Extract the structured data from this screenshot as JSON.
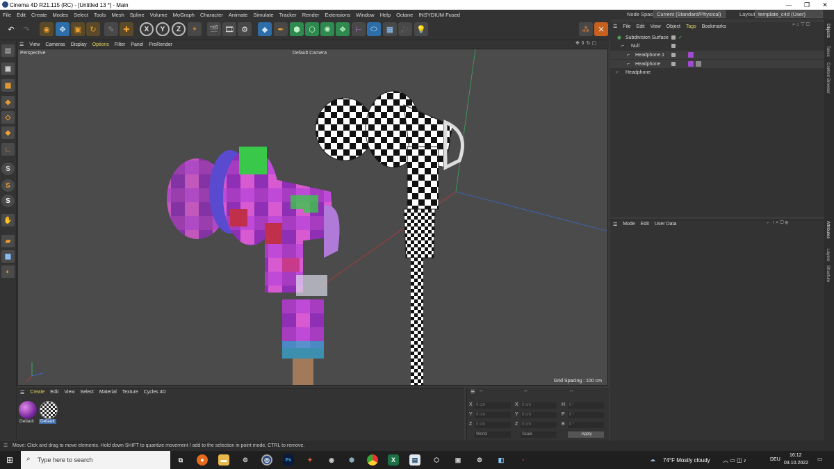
{
  "window": {
    "title": "Cinema 4D R21.115 (RC) - [Untitled 13 *] - Main",
    "minimize": "—",
    "maximize": "❐",
    "close": "✕"
  },
  "menubar": {
    "items": [
      "File",
      "Edit",
      "Create",
      "Modes",
      "Select",
      "Tools",
      "Mesh",
      "Spline",
      "Volume",
      "MoGraph",
      "Character",
      "Animate",
      "Simulate",
      "Tracker",
      "Render",
      "Extensions",
      "Window",
      "Help",
      "Octane",
      "INSYDIUM Fused"
    ],
    "node_space_label": "Node Space:",
    "node_space_value": "Current (Standard/Physical)",
    "layout_label": "Layout:",
    "layout_value": "template_c4d (User)"
  },
  "toolbar": {
    "x": "X",
    "y": "Y",
    "z": "Z"
  },
  "viewport": {
    "menu": [
      "View",
      "Cameras",
      "Display",
      "Options",
      "Filter",
      "Panel",
      "ProRender"
    ],
    "label": "Perspective",
    "camera": "Default Camera",
    "grid_spacing": "Grid Spacing : 100 cm"
  },
  "object_manager": {
    "menu": [
      "File",
      "Edit",
      "View",
      "Object",
      "Tags",
      "Bookmarks"
    ],
    "objects": [
      "Subdivision Surface",
      "Null",
      "Headphone.1",
      "Headphone",
      "Headphone"
    ]
  },
  "attributes": {
    "menu": [
      "Mode",
      "Edit",
      "User Data"
    ]
  },
  "right_tabs": [
    "Objects",
    "Takes",
    "Content Browser",
    "Attributes",
    "Layers",
    "Structure"
  ],
  "material_manager": {
    "menu": [
      "Create",
      "Edit",
      "View",
      "Select",
      "Material",
      "Texture",
      "Cycles 4D"
    ],
    "materials": [
      "Default",
      "Default"
    ]
  },
  "coordinates": {
    "header_left": "--",
    "header_mid": "--",
    "header_right": "--",
    "rows": [
      {
        "a": "X",
        "av": "0 cm",
        "b": "X",
        "bv": "0 cm",
        "c": "H",
        "cv": "0 °"
      },
      {
        "a": "Y",
        "av": "0 cm",
        "b": "Y",
        "bv": "0 cm",
        "c": "P",
        "cv": "0 °"
      },
      {
        "a": "Z",
        "av": "0 cm",
        "b": "Z",
        "bv": "0 cm",
        "c": "B",
        "cv": "0 °"
      }
    ],
    "mode1": "World",
    "mode2": "Scale",
    "apply": "Apply"
  },
  "statusbar": {
    "text": "Move: Click and drag to move elements. Hold down SHIFT to quantize movement / add to the selection in point mode, CTRL to remove."
  },
  "taskbar": {
    "search_placeholder": "Type here to search",
    "weather": "74°F  Mostly cloudy",
    "lang": "DEU",
    "time": "16:12",
    "date": "03.10.2022"
  },
  "colors": {
    "accent": "#e0d45a",
    "background": "#333333",
    "viewport": "#4b4b4b"
  }
}
